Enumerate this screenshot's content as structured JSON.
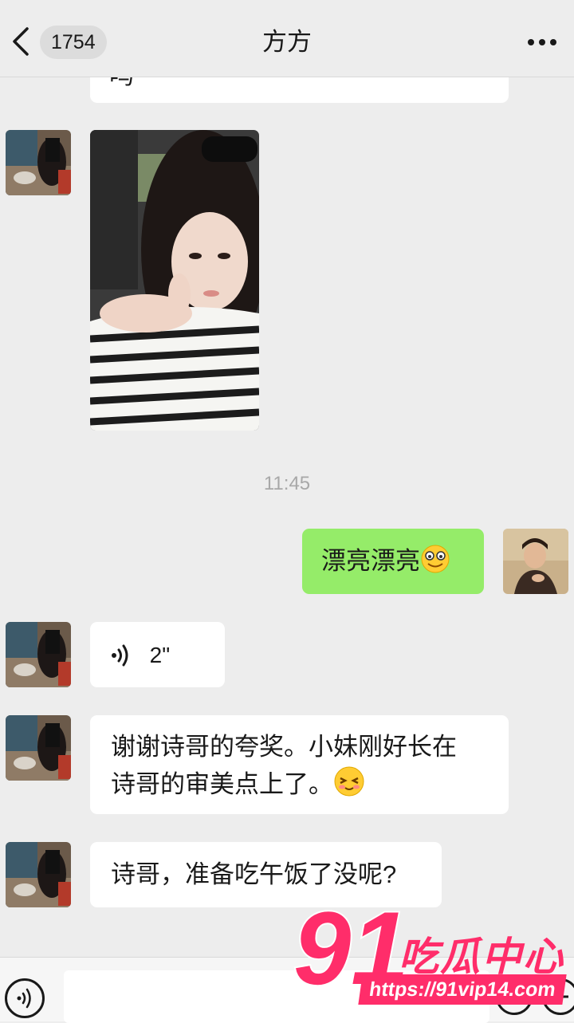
{
  "header": {
    "back_count": "1754",
    "title": "方方"
  },
  "chat": {
    "messages": [
      {
        "type": "text",
        "from": "contact",
        "text": "吗"
      },
      {
        "type": "image",
        "from": "contact"
      },
      {
        "type": "timestamp",
        "text": "11:45"
      },
      {
        "type": "text",
        "from": "me",
        "text": "漂亮漂亮"
      },
      {
        "type": "voice",
        "from": "contact",
        "duration": "2\""
      },
      {
        "type": "text",
        "from": "contact",
        "lines": [
          "谢谢诗哥的夸奖。小妹刚好长在",
          "诗哥的审美点上了。"
        ]
      },
      {
        "type": "text",
        "from": "contact",
        "text": "诗哥，准备吃午饭了没呢?"
      }
    ]
  },
  "watermark": {
    "number": "91",
    "brand": "吃瓜中心",
    "url": "https://91vip14.com"
  },
  "colors": {
    "background": "#ededed",
    "bubble_me": "#95ec69",
    "bubble_contact": "#ffffff",
    "watermark": "#ff2d6a"
  },
  "icons": [
    "chevron-left-icon",
    "more-dots-icon",
    "voice-wave-icon",
    "voice-toggle-icon",
    "emoji-icon",
    "plus-icon"
  ]
}
